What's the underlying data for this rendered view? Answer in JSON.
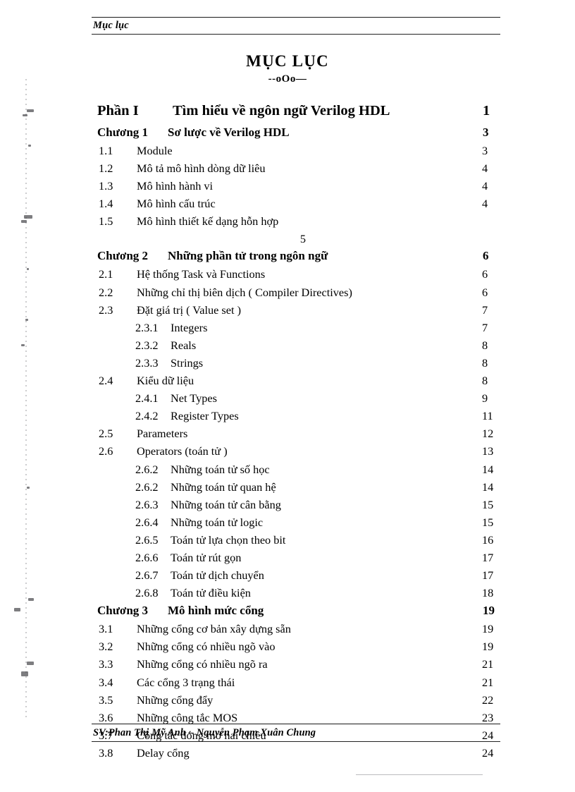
{
  "header": {
    "running_head": "Mục lục"
  },
  "title": {
    "heading": "MỤC  LỤC",
    "ornament": "--oOo—"
  },
  "toc": {
    "entries": [
      {
        "level": "part",
        "number": "Phần I",
        "title": "Tìm hiểu về ngôn ngữ Verilog HDL",
        "page": "1"
      },
      {
        "level": "chapter",
        "number": "Chương 1",
        "title": "Sơ lược về Verilog HDL",
        "page": "3"
      },
      {
        "level": "section",
        "number": "1.1",
        "title": "Module",
        "page": "3"
      },
      {
        "level": "section",
        "number": "1.2",
        "title": "Mô tả mô hình dòng dữ liêu",
        "page": "4"
      },
      {
        "level": "section",
        "number": "1.3",
        "title": "Mô hình  hành vi",
        "page": "4"
      },
      {
        "level": "section",
        "number": "1.4",
        "title": "Mô hình cấu trúc",
        "page": "4"
      },
      {
        "level": "section",
        "number": "1.5",
        "title": "Mô hình thiết kế dạng hỗn hợp",
        "page": ""
      },
      {
        "level": "orphan",
        "number": "",
        "title": "",
        "page": "5"
      },
      {
        "level": "chapter",
        "number": "Chương 2",
        "title": "Những phần tử trong ngôn ngữ",
        "page": "6"
      },
      {
        "level": "section",
        "number": "2.1",
        "title": "Hệ thống Task và Functions",
        "page": "6"
      },
      {
        "level": "section",
        "number": "2.2",
        "title": "Những chỉ thị biên dịch ( Compiler Directives)",
        "page": "6"
      },
      {
        "level": "section",
        "number": "2.3",
        "title": "Đặt giá trị ( Value set )",
        "page": "7"
      },
      {
        "level": "sub",
        "number": "2.3.1",
        "title": "Integers",
        "page": "7"
      },
      {
        "level": "sub",
        "number": "2.3.2",
        "title": "Reals",
        "page": "8"
      },
      {
        "level": "sub",
        "number": "2.3.3",
        "title": "Strings",
        "page": "8"
      },
      {
        "level": "section",
        "number": "2.4",
        "title": "Kiểu dữ liệu",
        "page": "8"
      },
      {
        "level": "sub",
        "number": "2.4.1",
        "title": "Net Types",
        "page": "9"
      },
      {
        "level": "sub",
        "number": "2.4.2",
        "title": "Register Types",
        "page": "11"
      },
      {
        "level": "section",
        "number": "2.5",
        "title": "Parameters",
        "page": "12"
      },
      {
        "level": "section",
        "number": "2.6",
        "title": "Operators (toán tử )",
        "page": "13"
      },
      {
        "level": "sub",
        "number": "2.6.2",
        "title": "Những toán tử số học",
        "page": "14"
      },
      {
        "level": "sub",
        "number": "2.6.2",
        "title": "Những toán tử quan hệ",
        "page": "14"
      },
      {
        "level": "sub",
        "number": "2.6.3",
        "title": "Những toán tử cân bằng",
        "page": "15"
      },
      {
        "level": "sub",
        "number": "2.6.4",
        "title": "Những toán tử logic",
        "page": "15"
      },
      {
        "level": "sub",
        "number": "2.6.5",
        "title": "Toán tử lựa chọn theo bit",
        "page": "16"
      },
      {
        "level": "sub",
        "number": "2.6.6",
        "title": "Toán tử rút gọn",
        "page": "17"
      },
      {
        "level": "sub",
        "number": "2.6.7",
        "title": "Toán tử dịch chuyển",
        "page": "17"
      },
      {
        "level": "sub",
        "number": "2.6.8",
        "title": "Toán tử điều kiện",
        "page": "18"
      },
      {
        "level": "chapter",
        "number": "Chương 3",
        "title": "Mô hình mức cổng",
        "page": "19"
      },
      {
        "level": "section",
        "number": "3.1",
        "title": "Những cổng cơ bản xây dựng sẵn",
        "page": "19"
      },
      {
        "level": "section",
        "number": "3.2",
        "title": "Những cổng có nhiều ngõ vào",
        "page": "19"
      },
      {
        "level": "section",
        "number": "3.3",
        "title": "Những cổng có nhiều ngõ ra",
        "page": "21"
      },
      {
        "level": "section",
        "number": "3.4",
        "title": "Các cổng 3 trạng thái",
        "page": "21"
      },
      {
        "level": "section",
        "number": "3.5",
        "title": "Những cổng đẩy",
        "page": "22"
      },
      {
        "level": "section",
        "number": "3.6",
        "title": "Những công tắc MOS",
        "page": "23"
      },
      {
        "level": "section",
        "number": "3.7",
        "title": "Công tắc đóng mở hai chiều",
        "page": "24"
      },
      {
        "level": "section",
        "number": "3.8",
        "title": "Delay cổng",
        "page": "24"
      }
    ]
  },
  "footer": {
    "authors": "SV:Phan Thị Mỹ Anh – Nguyễn Phạm Xuân Chung"
  }
}
